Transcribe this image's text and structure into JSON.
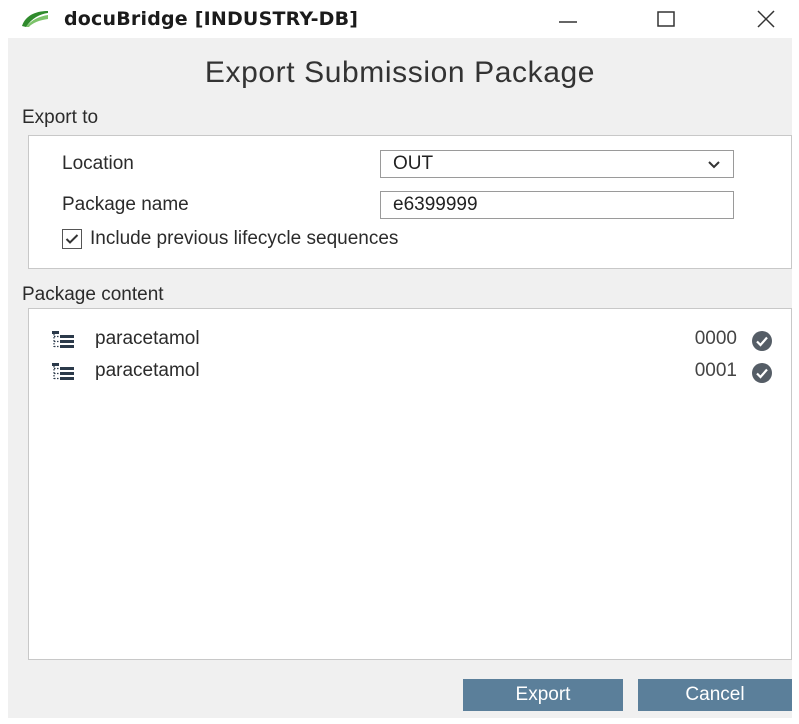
{
  "window": {
    "title": "docuBridge [INDUSTRY-DB]",
    "controls": {
      "minimize_icon": "minimize-icon",
      "maximize_icon": "maximize-icon",
      "close_icon": "close-icon"
    }
  },
  "dialog": {
    "title": "Export Submission Package"
  },
  "export_to": {
    "section_label": "Export to",
    "location": {
      "label": "Location",
      "value": "OUT"
    },
    "package_name": {
      "label": "Package name",
      "value": "e6399999"
    },
    "include_previous": {
      "label": "Include previous lifecycle sequences",
      "checked": true
    }
  },
  "package_content": {
    "section_label": "Package content",
    "items": [
      {
        "name": "paracetamol",
        "sequence": "0000",
        "status_icon": "check-circle-icon"
      },
      {
        "name": "paracetamol",
        "sequence": "0001",
        "status_icon": "check-circle-icon"
      }
    ]
  },
  "buttons": {
    "export_label": "Export",
    "cancel_label": "Cancel"
  },
  "colors": {
    "button": "#5b7f9a",
    "logo_green": "#3d9a3a",
    "dialog_bg": "#f0f0f0"
  }
}
